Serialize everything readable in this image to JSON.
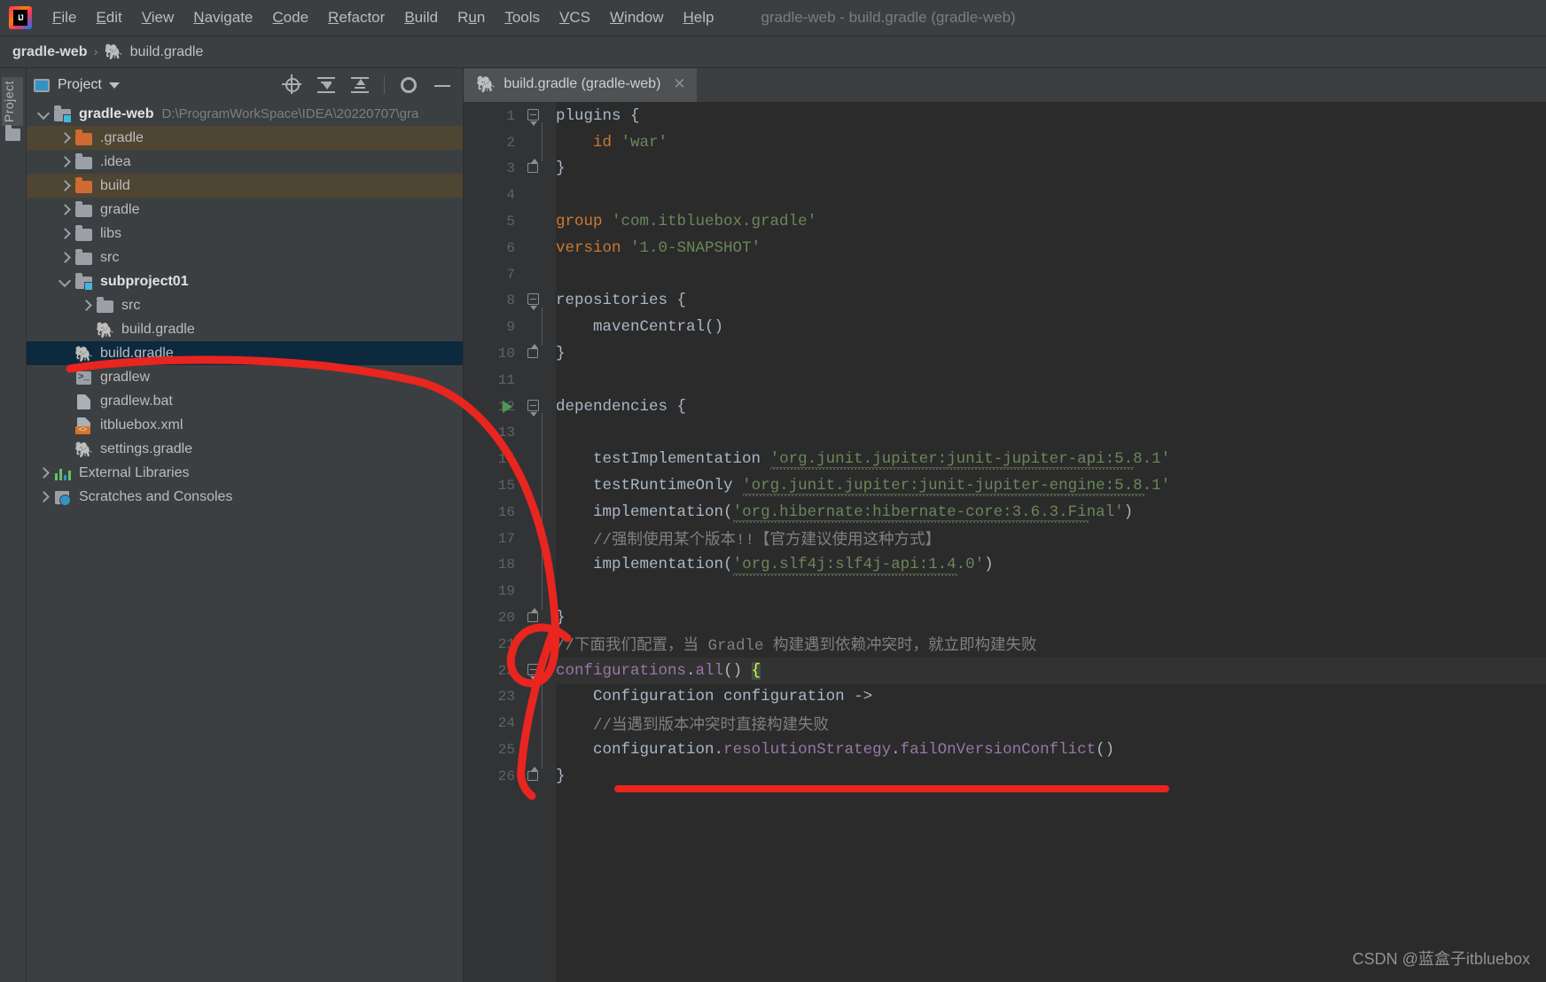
{
  "window": {
    "title": "gradle-web - build.gradle (gradle-web)"
  },
  "menubar": {
    "logo_icon": "intellij-idea-logo",
    "items": [
      {
        "label": "File",
        "mnemonic": "F"
      },
      {
        "label": "Edit",
        "mnemonic": "E"
      },
      {
        "label": "View",
        "mnemonic": "V"
      },
      {
        "label": "Navigate",
        "mnemonic": "N"
      },
      {
        "label": "Code",
        "mnemonic": "C"
      },
      {
        "label": "Refactor",
        "mnemonic": "R"
      },
      {
        "label": "Build",
        "mnemonic": "B"
      },
      {
        "label": "Run",
        "mnemonic": "u"
      },
      {
        "label": "Tools",
        "mnemonic": "T"
      },
      {
        "label": "VCS",
        "mnemonic": "V"
      },
      {
        "label": "Window",
        "mnemonic": "W"
      },
      {
        "label": "Help",
        "mnemonic": "H"
      }
    ]
  },
  "breadcrumb": {
    "root": "gradle-web",
    "separator": "›",
    "file": "build.gradle",
    "file_icon": "gradle-elephant-icon"
  },
  "toolstrip": {
    "project_tab": "Project",
    "structure_icon": "folder-icon"
  },
  "project_panel": {
    "title": "Project",
    "title_icon": "project-view-icon",
    "dropdown_icon": "chevron-down-icon",
    "actions": [
      {
        "name": "select-opened-file",
        "icon": "crosshair-target-icon",
        "tooltip": "Select Opened File"
      },
      {
        "name": "expand-all",
        "icon": "expand-all-icon",
        "tooltip": "Expand All"
      },
      {
        "name": "collapse-all",
        "icon": "collapse-all-icon",
        "tooltip": "Collapse All"
      },
      {
        "name": "settings",
        "icon": "gear-icon",
        "tooltip": "Settings"
      },
      {
        "name": "hide",
        "icon": "minimize-icon",
        "tooltip": "Hide"
      }
    ],
    "tree": [
      {
        "label": "gradle-web",
        "path": "D:\\ProgramWorkSpace\\IDEA\\20220707\\gra",
        "indent": 0,
        "twist": "down",
        "icon": "module-folder-icon",
        "bold": true,
        "state": "normal"
      },
      {
        "label": ".gradle",
        "indent": 1,
        "twist": "right",
        "icon": "folder-orange-icon",
        "bold": false,
        "state": "excluded"
      },
      {
        "label": ".idea",
        "indent": 1,
        "twist": "right",
        "icon": "folder-icon",
        "bold": false,
        "state": "normal"
      },
      {
        "label": "build",
        "indent": 1,
        "twist": "right",
        "icon": "folder-orange-icon",
        "bold": false,
        "state": "excluded"
      },
      {
        "label": "gradle",
        "indent": 1,
        "twist": "right",
        "icon": "folder-icon",
        "bold": false,
        "state": "normal"
      },
      {
        "label": "libs",
        "indent": 1,
        "twist": "right",
        "icon": "folder-icon",
        "bold": false,
        "state": "normal"
      },
      {
        "label": "src",
        "indent": 1,
        "twist": "right",
        "icon": "folder-icon",
        "bold": false,
        "state": "normal"
      },
      {
        "label": "subproject01",
        "indent": 1,
        "twist": "down",
        "icon": "module-folder-icon",
        "bold": true,
        "state": "normal"
      },
      {
        "label": "src",
        "indent": 2,
        "twist": "right",
        "icon": "folder-icon",
        "bold": false,
        "state": "normal"
      },
      {
        "label": "build.gradle",
        "indent": 2,
        "twist": "none",
        "icon": "gradle-elephant-icon",
        "bold": false,
        "state": "normal"
      },
      {
        "label": "build.gradle",
        "indent": 1,
        "twist": "none",
        "icon": "gradle-elephant-icon",
        "bold": false,
        "state": "selected"
      },
      {
        "label": "gradlew",
        "indent": 1,
        "twist": "none",
        "icon": "shell-script-icon",
        "bold": false,
        "state": "normal"
      },
      {
        "label": "gradlew.bat",
        "indent": 1,
        "twist": "none",
        "icon": "batch-file-icon",
        "bold": false,
        "state": "normal"
      },
      {
        "label": "itbluebox.xml",
        "indent": 1,
        "twist": "none",
        "icon": "xml-file-icon",
        "bold": false,
        "state": "normal"
      },
      {
        "label": "settings.gradle",
        "indent": 1,
        "twist": "none",
        "icon": "gradle-elephant-icon",
        "bold": false,
        "state": "normal"
      },
      {
        "label": "External Libraries",
        "indent": 0,
        "twist": "right",
        "icon": "libraries-icon",
        "bold": false,
        "state": "normal"
      },
      {
        "label": "Scratches and Consoles",
        "indent": 0,
        "twist": "right",
        "icon": "scratches-icon",
        "bold": false,
        "state": "normal"
      }
    ]
  },
  "editor": {
    "tab": {
      "label": "build.gradle (gradle-web)",
      "icon": "gradle-elephant-icon",
      "close_icon": "close-icon"
    },
    "lines": [
      {
        "n": 1,
        "fold": "open",
        "text": "plugins {"
      },
      {
        "n": 2,
        "fold": "none",
        "text": "    id 'war'"
      },
      {
        "n": 3,
        "fold": "end",
        "text": "}"
      },
      {
        "n": 4,
        "fold": "none",
        "text": ""
      },
      {
        "n": 5,
        "fold": "none",
        "text": "group 'com.itbluebox.gradle'"
      },
      {
        "n": 6,
        "fold": "none",
        "text": "version '1.0-SNAPSHOT'"
      },
      {
        "n": 7,
        "fold": "none",
        "text": ""
      },
      {
        "n": 8,
        "fold": "open",
        "text": "repositories {"
      },
      {
        "n": 9,
        "fold": "none",
        "text": "    mavenCentral()"
      },
      {
        "n": 10,
        "fold": "end",
        "text": "}"
      },
      {
        "n": 11,
        "fold": "none",
        "text": ""
      },
      {
        "n": 12,
        "fold": "open",
        "text": "dependencies {",
        "gutter_run": true
      },
      {
        "n": 13,
        "fold": "none",
        "text": ""
      },
      {
        "n": 14,
        "fold": "none",
        "text": "    testImplementation 'org.junit.jupiter:junit-jupiter-api:5.8.1'"
      },
      {
        "n": 15,
        "fold": "none",
        "text": "    testRuntimeOnly 'org.junit.jupiter:junit-jupiter-engine:5.8.1'"
      },
      {
        "n": 16,
        "fold": "none",
        "text": "    implementation('org.hibernate:hibernate-core:3.6.3.Final')"
      },
      {
        "n": 17,
        "fold": "none",
        "text": "    //强制使用某个版本!!【官方建议使用这种方式】"
      },
      {
        "n": 18,
        "fold": "none",
        "text": "    implementation('org.slf4j:slf4j-api:1.4.0')"
      },
      {
        "n": 19,
        "fold": "none",
        "text": ""
      },
      {
        "n": 20,
        "fold": "end",
        "text": "}"
      },
      {
        "n": 21,
        "fold": "none",
        "text": "//下面我们配置，当 Gradle 构建遇到依赖冲突时，就立即构建失败"
      },
      {
        "n": 22,
        "fold": "open",
        "text": "configurations.all() {",
        "current": true
      },
      {
        "n": 23,
        "fold": "none",
        "text": "    Configuration configuration ->"
      },
      {
        "n": 24,
        "fold": "none",
        "text": "    //当遇到版本冲突时直接构建失败"
      },
      {
        "n": 25,
        "fold": "none",
        "text": "    configuration.resolutionStrategy.failOnVersionConflict()"
      },
      {
        "n": 26,
        "fold": "end",
        "text": "}"
      }
    ]
  },
  "annotations": {
    "marker_color": "#e8251f",
    "shapes": [
      "curved-arrow-from-build-gradle-tree-item-to-configurations-block",
      "underline-below-closing-brace-line-26"
    ]
  },
  "watermark": {
    "text": "CSDN @蓝盒子itbluebox"
  },
  "colors": {
    "window_bg": "#3c3f41",
    "editor_bg": "#2b2b2b",
    "gutter_bg": "#313335",
    "selection_bg": "#0d293e",
    "excluded_bg": "#4e4632",
    "keyword": "#cc7832",
    "string": "#6a8759",
    "comment": "#808080",
    "property": "#9876aa",
    "text": "#a9b7c6",
    "marker_red": "#e8251f"
  }
}
